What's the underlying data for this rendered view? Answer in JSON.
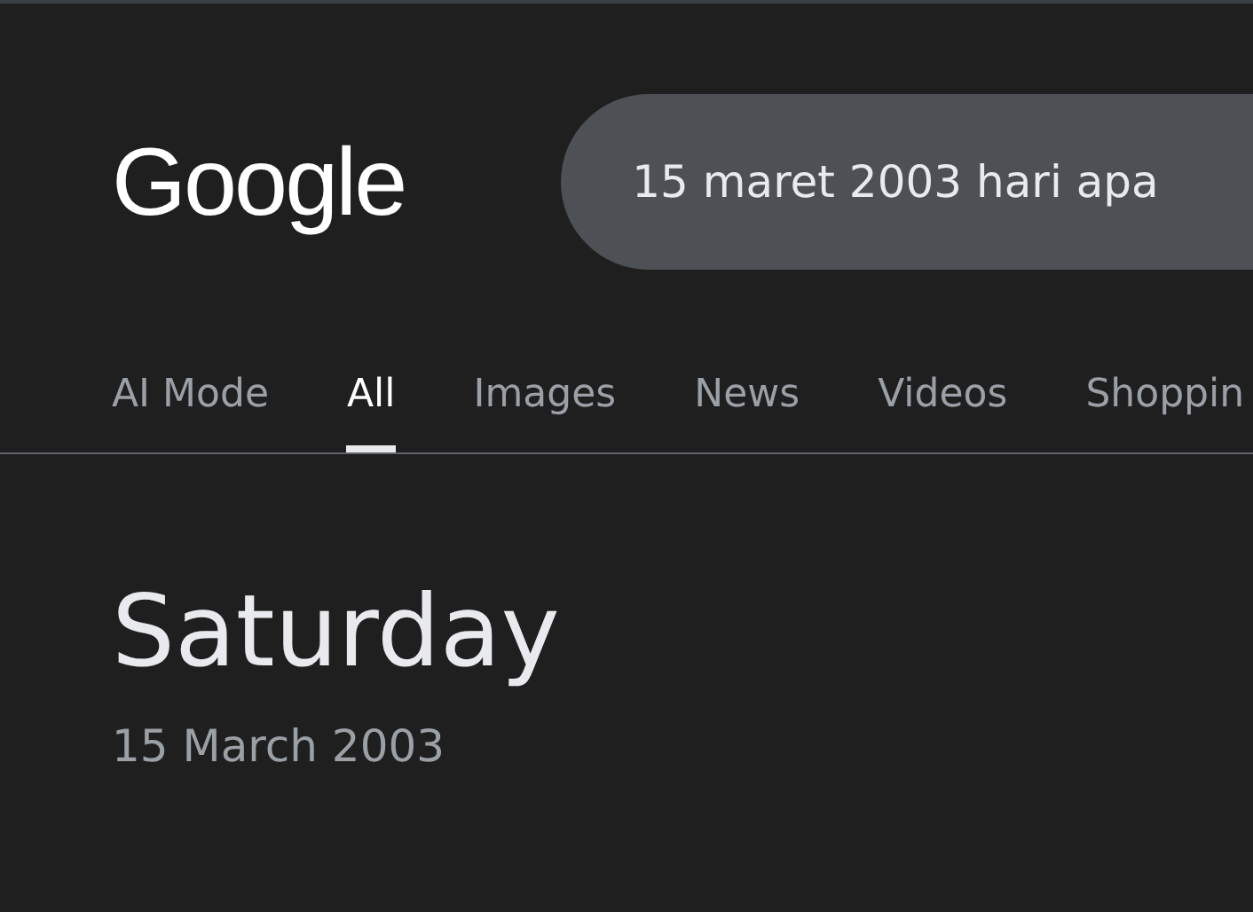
{
  "header": {
    "logo": "Google",
    "search": {
      "value": "15 maret 2003 hari apa"
    }
  },
  "tabs": [
    {
      "label": "AI Mode",
      "selected": false
    },
    {
      "label": "All",
      "selected": true
    },
    {
      "label": "Images",
      "selected": false
    },
    {
      "label": "News",
      "selected": false
    },
    {
      "label": "Videos",
      "selected": false
    },
    {
      "label": "Shoppin",
      "selected": false
    }
  ],
  "answer": {
    "title": "Saturday",
    "subtitle": "15 March 2003"
  }
}
